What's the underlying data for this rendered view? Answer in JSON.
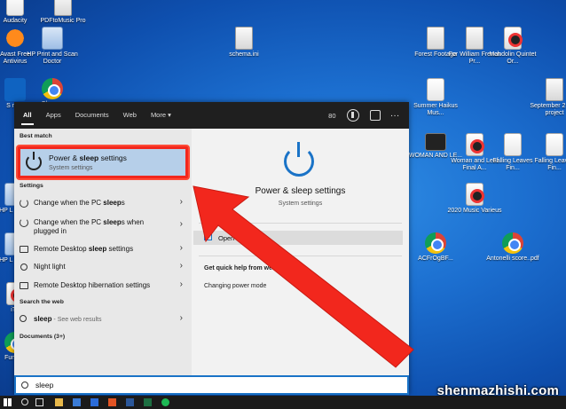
{
  "desktop_icons": [
    {
      "name": "Audacity",
      "icon": "audio-icon",
      "kind": "audio"
    },
    {
      "name": "PDFtoMusic Pro",
      "icon": "music-icon",
      "kind": "file"
    },
    {
      "name": "Avast Free Antivirus",
      "icon": "avast-icon",
      "kind": "avast"
    },
    {
      "name": "HP Print and Scan Doctor",
      "icon": "hp-icon",
      "kind": "hp"
    },
    {
      "name": "schema.ini",
      "icon": "file-icon",
      "kind": "file"
    },
    {
      "name": "Forest Footage",
      "icon": "file-icon",
      "kind": "file"
    },
    {
      "name": "For William French Pr...",
      "icon": "file-icon",
      "kind": "file"
    },
    {
      "name": "Mandolin Quintet Or...",
      "icon": "music-icon",
      "kind": "music"
    },
    {
      "name": "S mim",
      "icon": "outlook-icon",
      "kind": "outlook"
    },
    {
      "name": "Chrome",
      "icon": "chrome-icon",
      "kind": "chrome"
    },
    {
      "name": "Summer Haikus Mus...",
      "icon": "audio-icon",
      "kind": "audio"
    },
    {
      "name": "September 2 loop project",
      "icon": "file-icon",
      "kind": "file"
    },
    {
      "name": "WOMAN AND LE...",
      "icon": "video-icon",
      "kind": "video"
    },
    {
      "name": "Woman and Leaf Final A...",
      "icon": "music-icon",
      "kind": "music"
    },
    {
      "name": "Falling Leaves Fin...",
      "icon": "audio-icon",
      "kind": "audio"
    },
    {
      "name": "Falling Leaves Fin...",
      "icon": "audio-icon",
      "kind": "audio"
    },
    {
      "name": "2020 Music Varieus",
      "icon": "music-icon",
      "kind": "music"
    },
    {
      "name": "ACFrOgBF...",
      "icon": "chrome-icon",
      "kind": "chrome"
    },
    {
      "name": "Antonelli score..pdf",
      "icon": "chrome-icon",
      "kind": "chrome"
    },
    {
      "name": "HP L Pro M",
      "icon": "hp-icon",
      "kind": "hp"
    },
    {
      "name": "HP L Pro M",
      "icon": "hp-icon",
      "kind": "hp"
    },
    {
      "name": "iTu",
      "icon": "music-icon",
      "kind": "music"
    },
    {
      "name": "Fun Wil",
      "icon": "chrome-icon",
      "kind": "chrome"
    }
  ],
  "start_menu": {
    "tabs": [
      "All",
      "Apps",
      "Documents",
      "Web",
      "More ▾"
    ],
    "points": "80",
    "more_dots": "···",
    "best_match_heading": "Best match",
    "best_match": {
      "title_pre": "Power & ",
      "title_bold": "sleep",
      "title_post": " settings",
      "subtitle": "System settings"
    },
    "settings_heading": "Settings",
    "settings_items": [
      {
        "pre": "Change when the PC ",
        "bold": "sleep",
        "post": "s",
        "icon": "power-icon"
      },
      {
        "pre": "Change when the PC ",
        "bold": "sleep",
        "post": "s when plugged in",
        "icon": "power-icon"
      },
      {
        "pre": "Remote Desktop ",
        "bold": "sleep",
        "post": " settings",
        "icon": "monitor-icon"
      },
      {
        "pre": "Night light",
        "bold": "",
        "post": "",
        "icon": "sun-icon"
      },
      {
        "pre": "Remote Desktop hibernation settings",
        "bold": "",
        "post": "",
        "icon": "monitor-icon"
      }
    ],
    "search_web_heading": "Search the web",
    "web_item": {
      "bold": "sleep",
      "post": " - See web results"
    },
    "documents_heading": "Documents (3+)",
    "detail": {
      "title": "Power & sleep settings",
      "subtitle": "System settings",
      "open_label": "Open",
      "web_help_heading": "Get quick help from web",
      "web_help_link": "Changing power mode"
    },
    "search_query": "sleep"
  },
  "watermark": "shenmazhishi.com",
  "colors": {
    "accent": "#1a73c7",
    "highlight": "#b6cfe9",
    "annotation": "#f2271d"
  }
}
